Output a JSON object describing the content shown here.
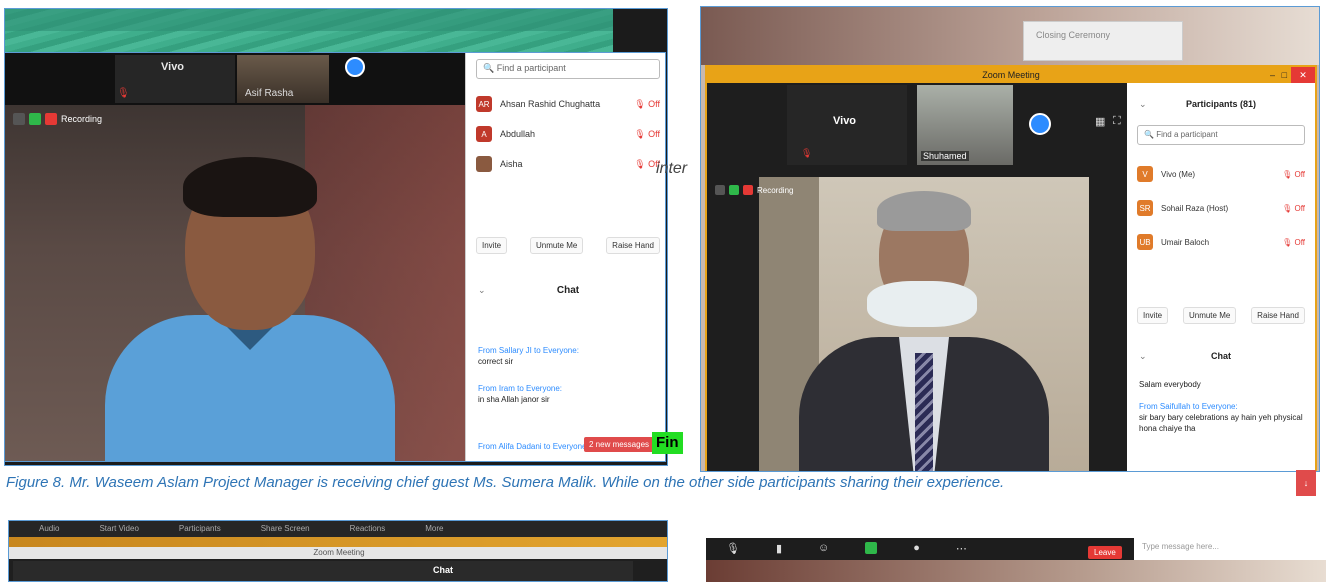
{
  "left": {
    "thumbs": {
      "vivo": "Vivo",
      "asif": "Asif Rasha"
    },
    "recording_label": "Recording",
    "search_placeholder": "Find a participant",
    "participants": [
      {
        "initials": "AR",
        "name": "Ahsan Rashid Chughatta",
        "status": "Off",
        "color": "#c0392b"
      },
      {
        "initials": "A",
        "name": "Abdullah",
        "status": "Off",
        "color": "#c0392b"
      },
      {
        "initials": "",
        "name": "Aisha",
        "status": "Off",
        "color": "#8a5a40"
      }
    ],
    "actions": {
      "invite": "Invite",
      "unmute": "Unmute Me",
      "raise": "Raise Hand"
    },
    "chat_title": "Chat",
    "messages": [
      {
        "from": "From Sallary JI to Everyone:",
        "text": "correct sir"
      },
      {
        "from": "From Iram to Everyone:",
        "text": "in sha Allah janor sir"
      },
      {
        "from": "From Alifa Dadani to Everyone:",
        "text": ""
      }
    ],
    "new_messages": "2 new messages"
  },
  "overlay": {
    "inter": "inter",
    "fin": "Fin"
  },
  "right": {
    "sign": "Closing Ceremony",
    "window_title": "Zoom Meeting",
    "thumbs": {
      "vivo": "Vivo",
      "shm": "Shuhamed"
    },
    "recording_label": "Recording",
    "panel_title": "Participants (81)",
    "search_placeholder": "Find a participant",
    "participants": [
      {
        "initials": "V",
        "name": "Vivo (Me)",
        "status": "Off"
      },
      {
        "initials": "SR",
        "name": "Sohail Raza (Host)",
        "status": "Off"
      },
      {
        "initials": "UB",
        "name": "Umair Baloch",
        "status": "Off"
      }
    ],
    "actions": {
      "invite": "Invite",
      "unmute": "Unmute Me",
      "raise": "Raise Hand"
    },
    "chat_title": "Chat",
    "messages": [
      {
        "from": "",
        "text": "Salam everybody"
      },
      {
        "from": "From Saifullah to Everyone:",
        "text": "sir bary bary celebrations ay hain yeh physical hona chaiye tha"
      }
    ]
  },
  "caption": "Figure 8. Mr. Waseem Aslam Project Manager is receiving chief guest Ms. Sumera Malik. While on the other side participants sharing their experience.",
  "lower_left": {
    "toolbar": [
      "Audio",
      "Start Video",
      "Participants",
      "Share Screen",
      "Reactions",
      "More"
    ],
    "title": "Zoom Meeting",
    "chat": "Chat"
  },
  "lower_right": {
    "leave": "Leave",
    "chat_placeholder": "Type message here..."
  }
}
